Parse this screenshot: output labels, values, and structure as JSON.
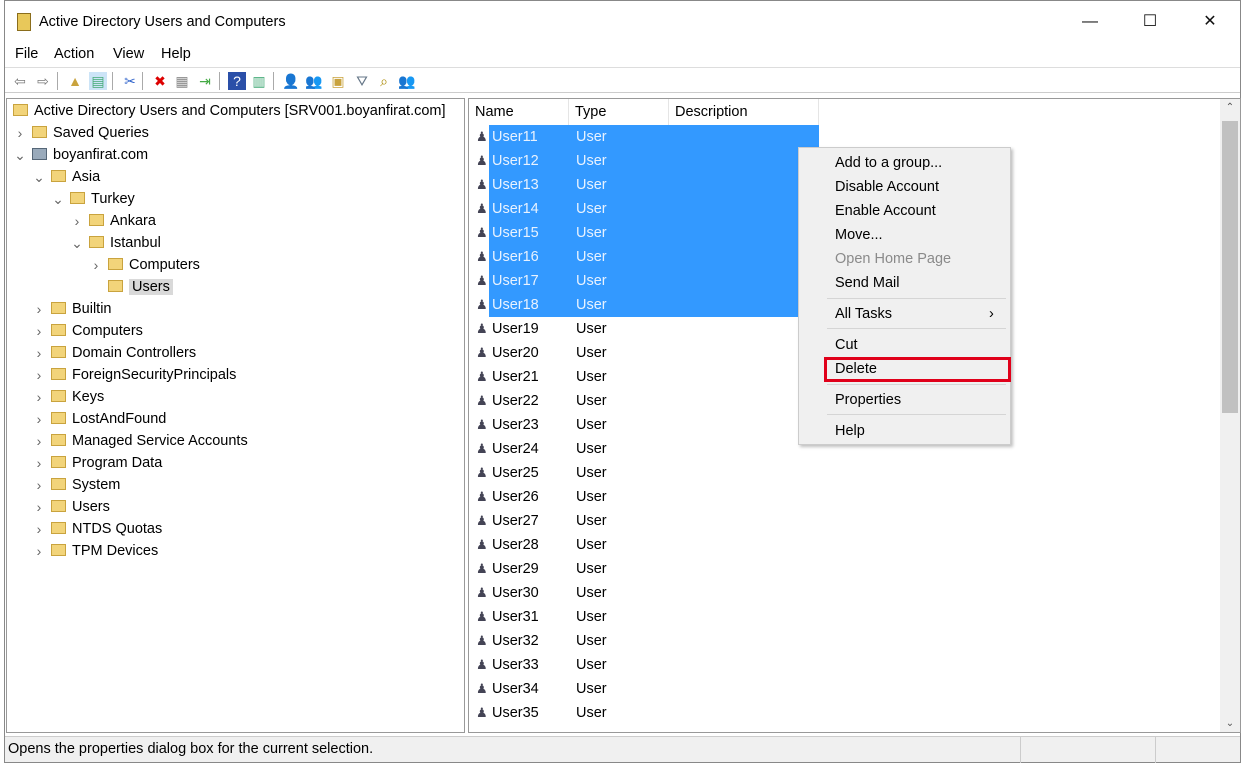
{
  "window": {
    "title": "Active Directory Users and Computers",
    "controls": [
      "minimize",
      "maximize",
      "close"
    ]
  },
  "menu": [
    "File",
    "Action",
    "View",
    "Help"
  ],
  "toolbar": [
    "back-icon",
    "forward-icon",
    "up-folder-icon",
    "show-hide-tree-icon",
    "cut-icon",
    "delete-icon",
    "properties-icon",
    "export-list-icon",
    "help-icon",
    "action-pane-icon",
    "new-user-icon",
    "new-group-icon",
    "new-ou-icon",
    "filter-icon",
    "find-icon",
    "add-to-group-icon"
  ],
  "tree": [
    {
      "label": "Active Directory Users and Computers [SRV001.boyanfirat.com]",
      "level": 0,
      "exp": ""
    },
    {
      "label": "Saved Queries",
      "level": 1,
      "exp": ">"
    },
    {
      "label": "boyanfirat.com",
      "level": 1,
      "exp": "v"
    },
    {
      "label": "Asia",
      "level": 2,
      "exp": "v"
    },
    {
      "label": "Turkey",
      "level": 3,
      "exp": "v"
    },
    {
      "label": "Ankara",
      "level": 4,
      "exp": ">"
    },
    {
      "label": "Istanbul",
      "level": 4,
      "exp": "v"
    },
    {
      "label": "Computers",
      "level": 5,
      "exp": ">"
    },
    {
      "label": "Users",
      "level": 5,
      "exp": "",
      "selected": true
    },
    {
      "label": "Builtin",
      "level": 2,
      "exp": ">"
    },
    {
      "label": "Computers",
      "level": 2,
      "exp": ">"
    },
    {
      "label": "Domain Controllers",
      "level": 2,
      "exp": ">"
    },
    {
      "label": "ForeignSecurityPrincipals",
      "level": 2,
      "exp": ">"
    },
    {
      "label": "Keys",
      "level": 2,
      "exp": ">"
    },
    {
      "label": "LostAndFound",
      "level": 2,
      "exp": ">"
    },
    {
      "label": "Managed Service Accounts",
      "level": 2,
      "exp": ">"
    },
    {
      "label": "Program Data",
      "level": 2,
      "exp": ">"
    },
    {
      "label": "System",
      "level": 2,
      "exp": ">"
    },
    {
      "label": "Users",
      "level": 2,
      "exp": ">"
    },
    {
      "label": "NTDS Quotas",
      "level": 2,
      "exp": ">"
    },
    {
      "label": "TPM Devices",
      "level": 2,
      "exp": ">"
    }
  ],
  "list": {
    "columns": [
      "Name",
      "Type",
      "Description"
    ],
    "rows": [
      {
        "name": "User11",
        "type": "User",
        "selected": true
      },
      {
        "name": "User12",
        "type": "User",
        "selected": true
      },
      {
        "name": "User13",
        "type": "User",
        "selected": true
      },
      {
        "name": "User14",
        "type": "User",
        "selected": true
      },
      {
        "name": "User15",
        "type": "User",
        "selected": true
      },
      {
        "name": "User16",
        "type": "User",
        "selected": true
      },
      {
        "name": "User17",
        "type": "User",
        "selected": true
      },
      {
        "name": "User18",
        "type": "User",
        "selected": true
      },
      {
        "name": "User19",
        "type": "User"
      },
      {
        "name": "User20",
        "type": "User"
      },
      {
        "name": "User21",
        "type": "User"
      },
      {
        "name": "User22",
        "type": "User"
      },
      {
        "name": "User23",
        "type": "User"
      },
      {
        "name": "User24",
        "type": "User"
      },
      {
        "name": "User25",
        "type": "User"
      },
      {
        "name": "User26",
        "type": "User"
      },
      {
        "name": "User27",
        "type": "User"
      },
      {
        "name": "User28",
        "type": "User"
      },
      {
        "name": "User29",
        "type": "User"
      },
      {
        "name": "User30",
        "type": "User"
      },
      {
        "name": "User31",
        "type": "User"
      },
      {
        "name": "User32",
        "type": "User"
      },
      {
        "name": "User33",
        "type": "User"
      },
      {
        "name": "User34",
        "type": "User"
      },
      {
        "name": "User35",
        "type": "User"
      }
    ]
  },
  "context_menu": {
    "items": [
      {
        "label": "Add to a group..."
      },
      {
        "label": "Disable Account"
      },
      {
        "label": "Enable Account"
      },
      {
        "label": "Move..."
      },
      {
        "label": "Open Home Page",
        "disabled": true
      },
      {
        "label": "Send Mail"
      },
      {
        "sep": true
      },
      {
        "label": "All Tasks",
        "submenu": true
      },
      {
        "sep": true
      },
      {
        "label": "Cut"
      },
      {
        "label": "Delete",
        "highlighted": true
      },
      {
        "sep": true
      },
      {
        "label": "Properties"
      },
      {
        "sep": true
      },
      {
        "label": "Help"
      }
    ],
    "highlight_color": "#e0001a"
  },
  "selection_color": "#3399ff",
  "status": "Opens the properties dialog box for the current selection."
}
